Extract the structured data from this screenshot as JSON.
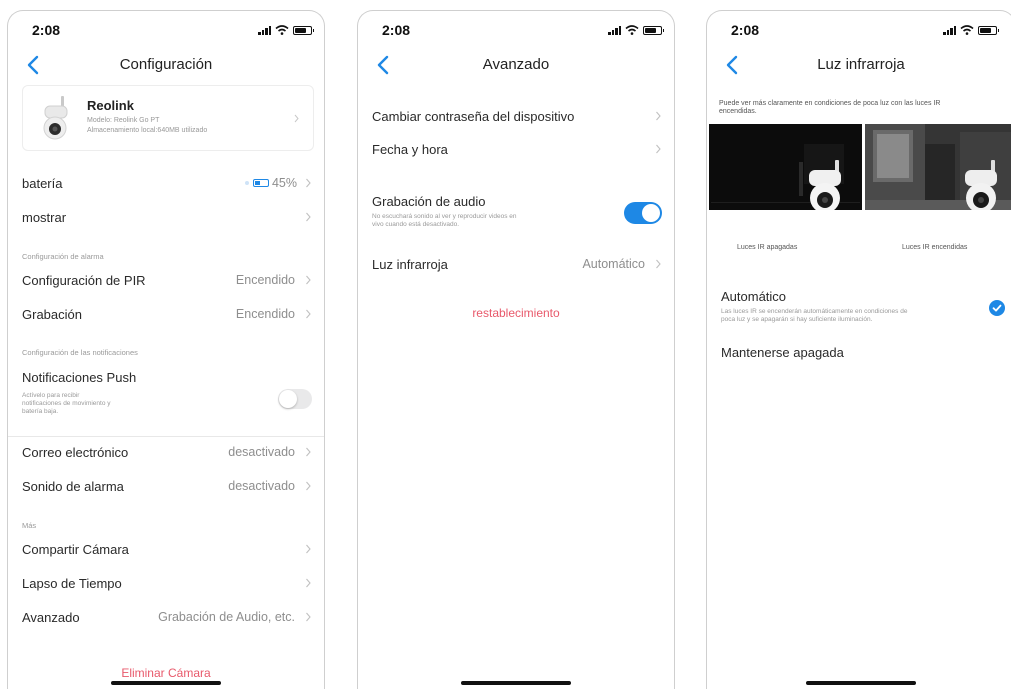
{
  "status": {
    "time": "2:08"
  },
  "screen1": {
    "title": "Configuración",
    "device": {
      "name": "Reolink",
      "model": "Modelo: Reolink Go PT",
      "storage": "Almacenamiento local:640MB utilizado"
    },
    "battery": {
      "label": "batería",
      "value": "45%"
    },
    "display": {
      "label": "mostrar"
    },
    "alarm_section": "Configuración de alarma",
    "pir": {
      "label": "Configuración de PIR",
      "value": "Encendido"
    },
    "recording": {
      "label": "Grabación",
      "value": "Encendido"
    },
    "notif_section": "Configuración de las notificaciones",
    "push": {
      "label": "Notificaciones Push",
      "desc_1": "Actívelo para recibir",
      "desc_2": "notificaciones de movimiento y",
      "desc_3": "batería baja.",
      "enabled": false
    },
    "email": {
      "label": "Correo electrónico",
      "value": "desactivado"
    },
    "alarm_sound": {
      "label": "Sonido de alarma",
      "value": "desactivado"
    },
    "more_section": "Más",
    "share": {
      "label": "Compartir Cámara"
    },
    "timelapse": {
      "label": "Lapso de Tiempo"
    },
    "advanced": {
      "label": "Avanzado",
      "value": "Grabación de Audio, etc."
    },
    "delete": "Eliminar Cámara"
  },
  "screen2": {
    "title": "Avanzado",
    "password": "Cambiar contraseña del dispositivo",
    "datetime": "Fecha y hora",
    "audio": {
      "label": "Grabación de audio",
      "desc_1": "No escuchará sonido al ver y reproducir videos en",
      "desc_2": "vivo cuando está desactivado.",
      "enabled": true
    },
    "ir": {
      "label": "Luz infrarroja",
      "value": "Automático"
    },
    "reset": "restablecimiento"
  },
  "screen3": {
    "title": "Luz infrarroja",
    "intro_1": "Puede ver más claramente en condiciones de poca luz con las luces IR",
    "intro_2": "encendidas.",
    "caption_off": "Luces IR apagadas",
    "caption_on": "Luces IR encendidas",
    "auto": {
      "label": "Automático",
      "desc_1": "Las luces IR se encenderán automáticamente en condiciones de",
      "desc_2": "poca luz y se apagarán si hay suficiente iluminación.",
      "selected": true
    },
    "off": {
      "label": "Mantenerse apagada"
    }
  },
  "colors": {
    "accent": "#1e88e5",
    "danger": "#e8596b",
    "back": "#1e88e5"
  },
  "icons": [
    "back-chevron-icon",
    "chevron-right-icon",
    "signal-icon",
    "wifi-icon",
    "battery-icon",
    "camera-thumbnail",
    "checkmark-icon"
  ]
}
